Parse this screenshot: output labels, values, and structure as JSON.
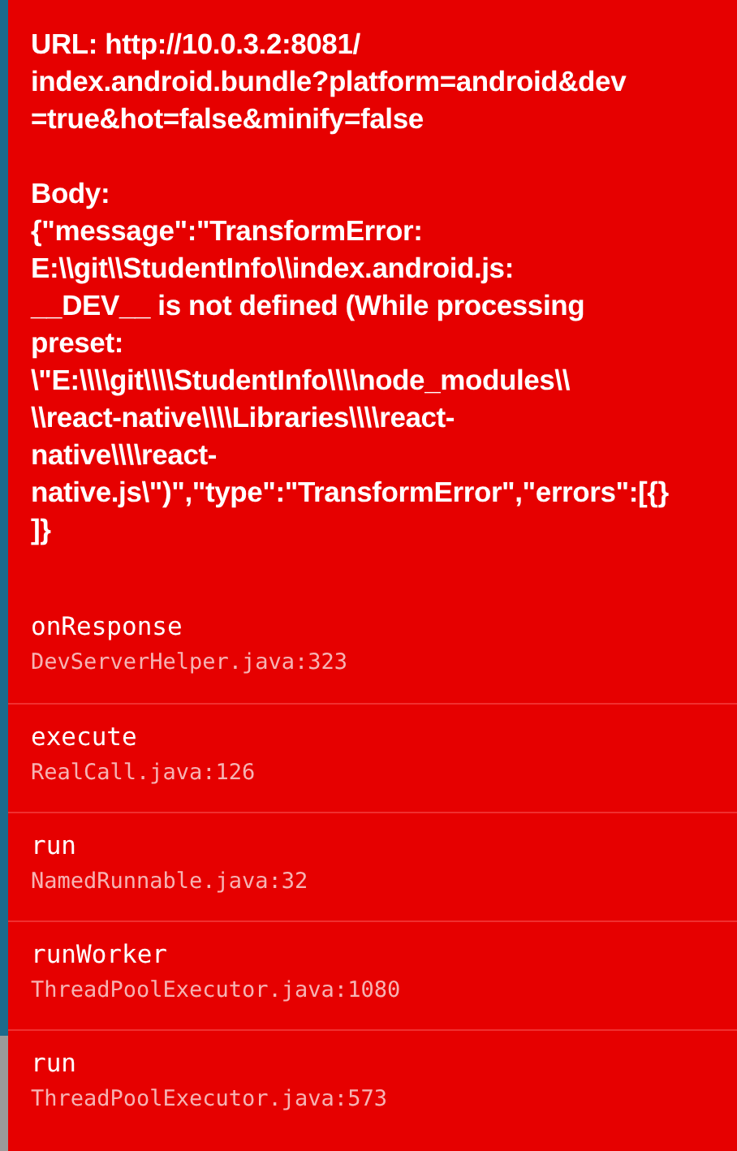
{
  "message": {
    "url": "URL: http://10.0.3.2:8081/\nindex.android.bundle?platform=android&dev\n=true&hot=false&minify=false",
    "body": "Body:\n{\"message\":\"TransformError:\nE:\\\\git\\\\StudentInfo\\\\index.android.js:\n__DEV__ is not defined (While processing\npreset:\n\\\"E:\\\\\\\\git\\\\\\\\StudentInfo\\\\\\\\node_modules\\\\\n\\\\react-native\\\\\\\\Libraries\\\\\\\\react-\nnative\\\\\\\\react-\nnative.js\\\")\",\"type\":\"TransformError\",\"errors\":[{}\n]}"
  },
  "stack_frames": [
    {
      "method": "onResponse",
      "location": "DevServerHelper.java:323"
    },
    {
      "method": "execute",
      "location": "RealCall.java:126"
    },
    {
      "method": "run",
      "location": "NamedRunnable.java:32"
    },
    {
      "method": "runWorker",
      "location": "ThreadPoolExecutor.java:1080"
    },
    {
      "method": "run",
      "location": "ThreadPoolExecutor.java:573"
    }
  ]
}
